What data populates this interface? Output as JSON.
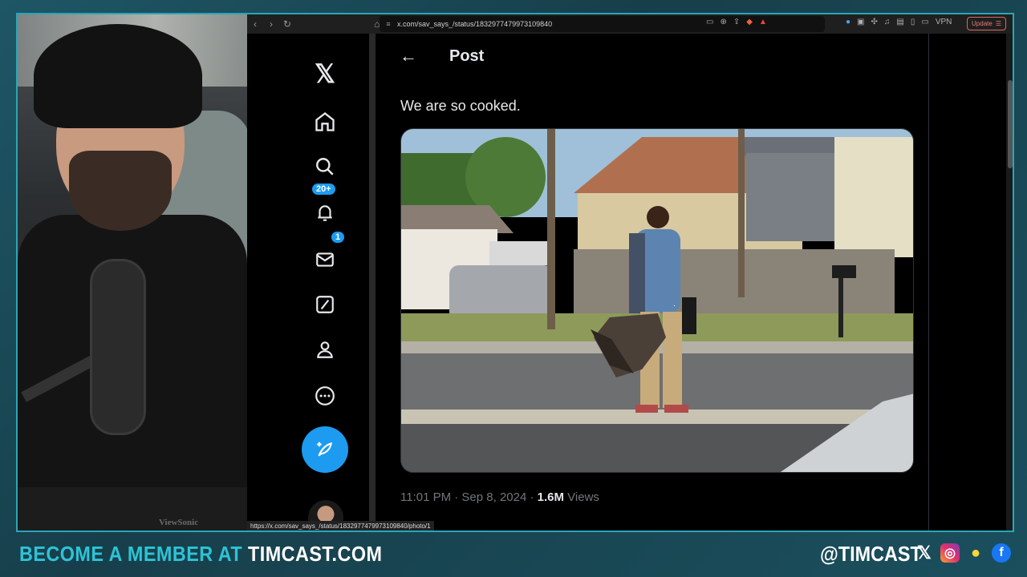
{
  "browser": {
    "url": "x.com/sav_says_/status/1832977479973109840",
    "vpn_label": "VPN",
    "update_label": "Update",
    "status_url": "https://x.com/sav_says_/status/1832977479973109840/photo/1"
  },
  "sidebar": {
    "notifications_badge": "20+",
    "messages_badge": "1"
  },
  "post": {
    "header_title": "Post",
    "text": "We are so cooked.",
    "time": "11:01 PM · Sep 8, 2024 · ",
    "views_count": "1.6M",
    "views_label": " Views"
  },
  "overlay": {
    "cta_prefix": "BECOME A MEMBER AT ",
    "cta_site": "TIMCAST.COM",
    "handle": "@TIMCAST",
    "monitor_brand": "ViewSonic"
  },
  "colors": {
    "accent": "#2ec3d6",
    "x_blue": "#1d9bf0"
  }
}
